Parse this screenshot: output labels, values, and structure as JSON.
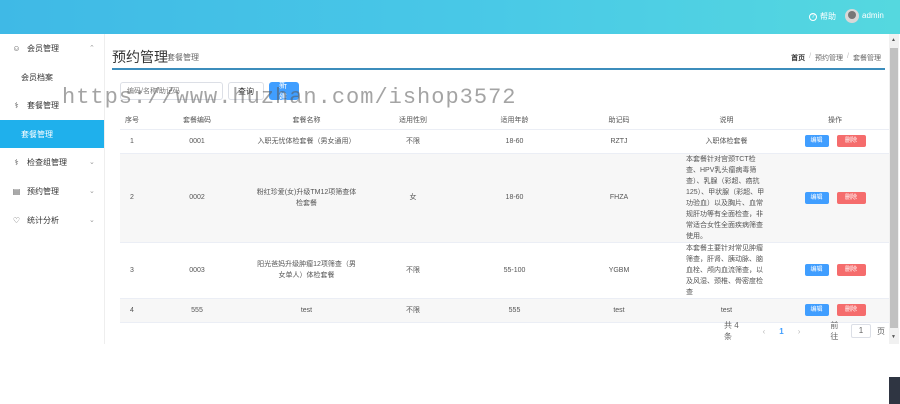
{
  "topbar": {
    "help_label": "帮助",
    "user_name": "admin"
  },
  "sidebar": {
    "groups": [
      {
        "label": "会员管理",
        "icon": "user-icon"
      },
      {
        "label": "套餐管理",
        "icon": "stethoscope-icon"
      },
      {
        "label": "检查组管理",
        "icon": "stethoscope-icon"
      },
      {
        "label": "预约管理",
        "icon": "calendar-icon"
      },
      {
        "label": "统计分析",
        "icon": "heart-pulse-icon"
      }
    ],
    "sub_items": [
      {
        "label": "会员档案"
      },
      {
        "label": "套餐管理"
      }
    ]
  },
  "header": {
    "title": "预约管理",
    "subtitle": "套餐管理",
    "breadcrumb": [
      "首页",
      "预约管理",
      "套餐管理"
    ]
  },
  "toolbar": {
    "search_placeholder": "编码/名称/助记码",
    "query_label": "查询",
    "new_label": "新建"
  },
  "table": {
    "columns": [
      "序号",
      "套餐编码",
      "套餐名称",
      "适用性别",
      "适用年龄",
      "助记码",
      "说明",
      "操作"
    ],
    "rows": [
      {
        "idx": "1",
        "code": "0001",
        "name": "入职无忧体检套餐（男女通用）",
        "sex": "不限",
        "age": "18-60",
        "mnemonic": "RZTJ",
        "desc": "入职体检套餐"
      },
      {
        "idx": "2",
        "code": "0002",
        "name": "粉红珍爱(女)升级TM12项筛查体检套餐",
        "sex": "女",
        "age": "18-60",
        "mnemonic": "FHZA",
        "desc": "本套餐针对宫颈TCT检查、HPV乳头瘤病毒筛查）、乳腺（彩超、癌抗125）、甲状腺（彩超、甲功验血）以及胸片、血常规肝功等有全面检查，非常适合女性全面疾病筛查使用。"
      },
      {
        "idx": "3",
        "code": "0003",
        "name": "阳光爸妈升级肿瘤12项筛查（男女单人）体检套餐",
        "sex": "不限",
        "age": "55-100",
        "mnemonic": "YGBM",
        "desc": "本套餐主要针对常见肿瘤筛查，肝肾、胰动脉、脑血栓、颅内血流筛查，以及风湿、颈椎、骨密度检查"
      },
      {
        "idx": "4",
        "code": "555",
        "name": "test",
        "sex": "不限",
        "age": "555",
        "mnemonic": "test",
        "desc": "test"
      }
    ],
    "edit_label": "编辑",
    "delete_label": "删除"
  },
  "pagination": {
    "total": "共 4 条",
    "current": "1",
    "goto_label": "前往",
    "goto_value": "1",
    "page_unit": "页"
  },
  "watermark": "https://www.huzhan.com/ishop3572",
  "colors": {
    "accent": "#409eff",
    "danger": "#f56c6c",
    "active_menu": "#1fb0ec",
    "topbar": "#49c9e7"
  }
}
